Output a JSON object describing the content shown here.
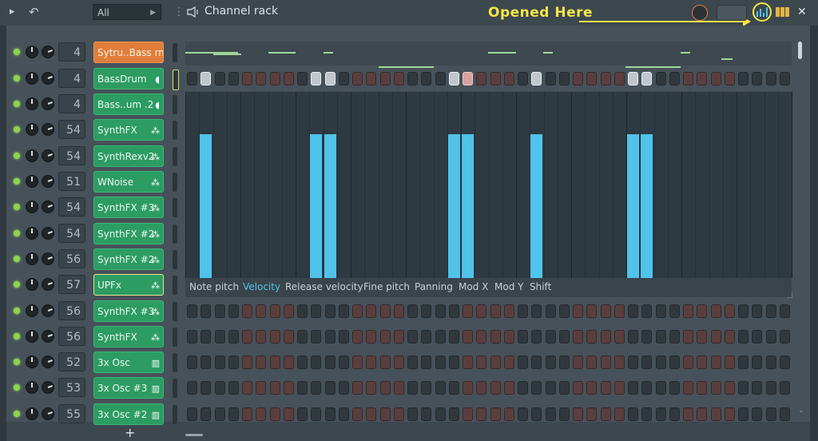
{
  "toolbar": {
    "play_icon": "▸",
    "undo_icon": "↶",
    "filter_value": "All",
    "title": "Channel rack",
    "callout": "Opened Here",
    "close_icon": "✕"
  },
  "channels": [
    {
      "num": "4",
      "name": "Sytru..Bass rm",
      "color": "orange",
      "icon": ""
    },
    {
      "num": "4",
      "name": "BassDrum",
      "color": "green",
      "icon": "◖"
    },
    {
      "num": "4",
      "name": "Bass..um .2",
      "color": "green",
      "icon": "◖"
    },
    {
      "num": "54",
      "name": "SynthFX",
      "color": "green",
      "icon": "⁂"
    },
    {
      "num": "54",
      "name": "SynthRexv2",
      "color": "green",
      "icon": "⁂"
    },
    {
      "num": "51",
      "name": "WNoise",
      "color": "green",
      "icon": "⁂"
    },
    {
      "num": "54",
      "name": "SynthFX #3",
      "color": "green",
      "icon": "⁂"
    },
    {
      "num": "54",
      "name": "SynthFX #2",
      "color": "green",
      "icon": "⁂"
    },
    {
      "num": "56",
      "name": "SynthFX #2",
      "color": "green",
      "icon": "⁂"
    },
    {
      "num": "57",
      "name": "UPFx",
      "color": "green",
      "icon": "⁂"
    },
    {
      "num": "56",
      "name": "SynthFX #3",
      "color": "green",
      "icon": "⁂"
    },
    {
      "num": "56",
      "name": "SynthFX",
      "color": "green",
      "icon": "⁂"
    },
    {
      "num": "52",
      "name": "3x Osc",
      "color": "green",
      "icon": "▥"
    },
    {
      "num": "53",
      "name": "3x Osc #3",
      "color": "green",
      "icon": "▥"
    },
    {
      "num": "55",
      "name": "3x Osc #2",
      "color": "green",
      "icon": "▥"
    }
  ],
  "bassdrum_steps_on": [
    1,
    9,
    10,
    19,
    20,
    25,
    32,
    33
  ],
  "graph_tabs": [
    "Note pitch",
    "Velocity",
    "Release velocity",
    "Fine pitch",
    "Panning",
    "Mod X",
    "Mod Y",
    "Shift"
  ],
  "active_tab": "Velocity",
  "velocity_steps": [
    1,
    9,
    10,
    19,
    20,
    25,
    32,
    33
  ],
  "add_icon": "+"
}
